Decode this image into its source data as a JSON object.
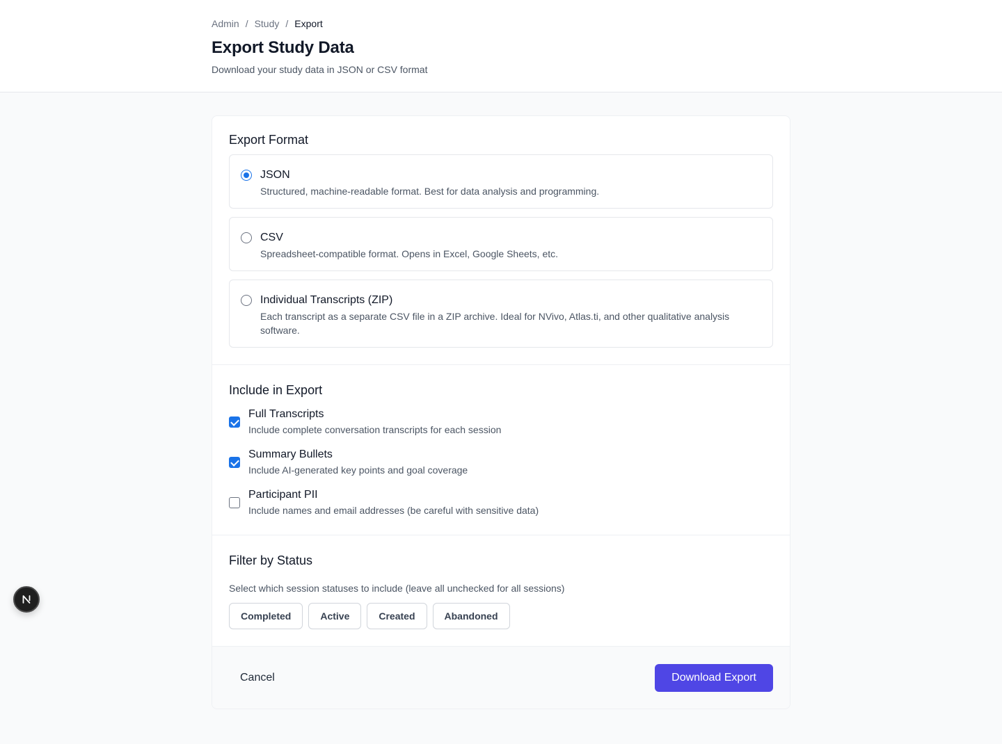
{
  "breadcrumb": {
    "items": [
      "Admin",
      "Study"
    ],
    "current": "Export",
    "separator": "/"
  },
  "header": {
    "title": "Export Study Data",
    "subtitle": "Download your study data in JSON or CSV format"
  },
  "export_format": {
    "title": "Export Format",
    "selected": "JSON",
    "options": [
      {
        "label": "JSON",
        "description": "Structured, machine-readable format. Best for data analysis and programming."
      },
      {
        "label": "CSV",
        "description": "Spreadsheet-compatible format. Opens in Excel, Google Sheets, etc."
      },
      {
        "label": "Individual Transcripts (ZIP)",
        "description": "Each transcript as a separate CSV file in a ZIP archive. Ideal for NVivo, Atlas.ti, and other qualitative analysis software."
      }
    ]
  },
  "include": {
    "title": "Include in Export",
    "items": [
      {
        "label": "Full Transcripts",
        "description": "Include complete conversation transcripts for each session",
        "checked": true
      },
      {
        "label": "Summary Bullets",
        "description": "Include AI-generated key points and goal coverage",
        "checked": true
      },
      {
        "label": "Participant PII",
        "description": "Include names and email addresses (be careful with sensitive data)",
        "checked": false
      }
    ]
  },
  "filter": {
    "title": "Filter by Status",
    "help": "Select which session statuses to include (leave all unchecked for all sessions)",
    "statuses": [
      "Completed",
      "Active",
      "Created",
      "Abandoned"
    ]
  },
  "footer": {
    "cancel_label": "Cancel",
    "download_label": "Download Export"
  },
  "floating_badge": {
    "icon": "nextjs-logo-icon",
    "letter": "N"
  },
  "colors": {
    "accent": "#4f46e5",
    "control_checked": "#1a73e8",
    "background": "#f9fafb"
  }
}
